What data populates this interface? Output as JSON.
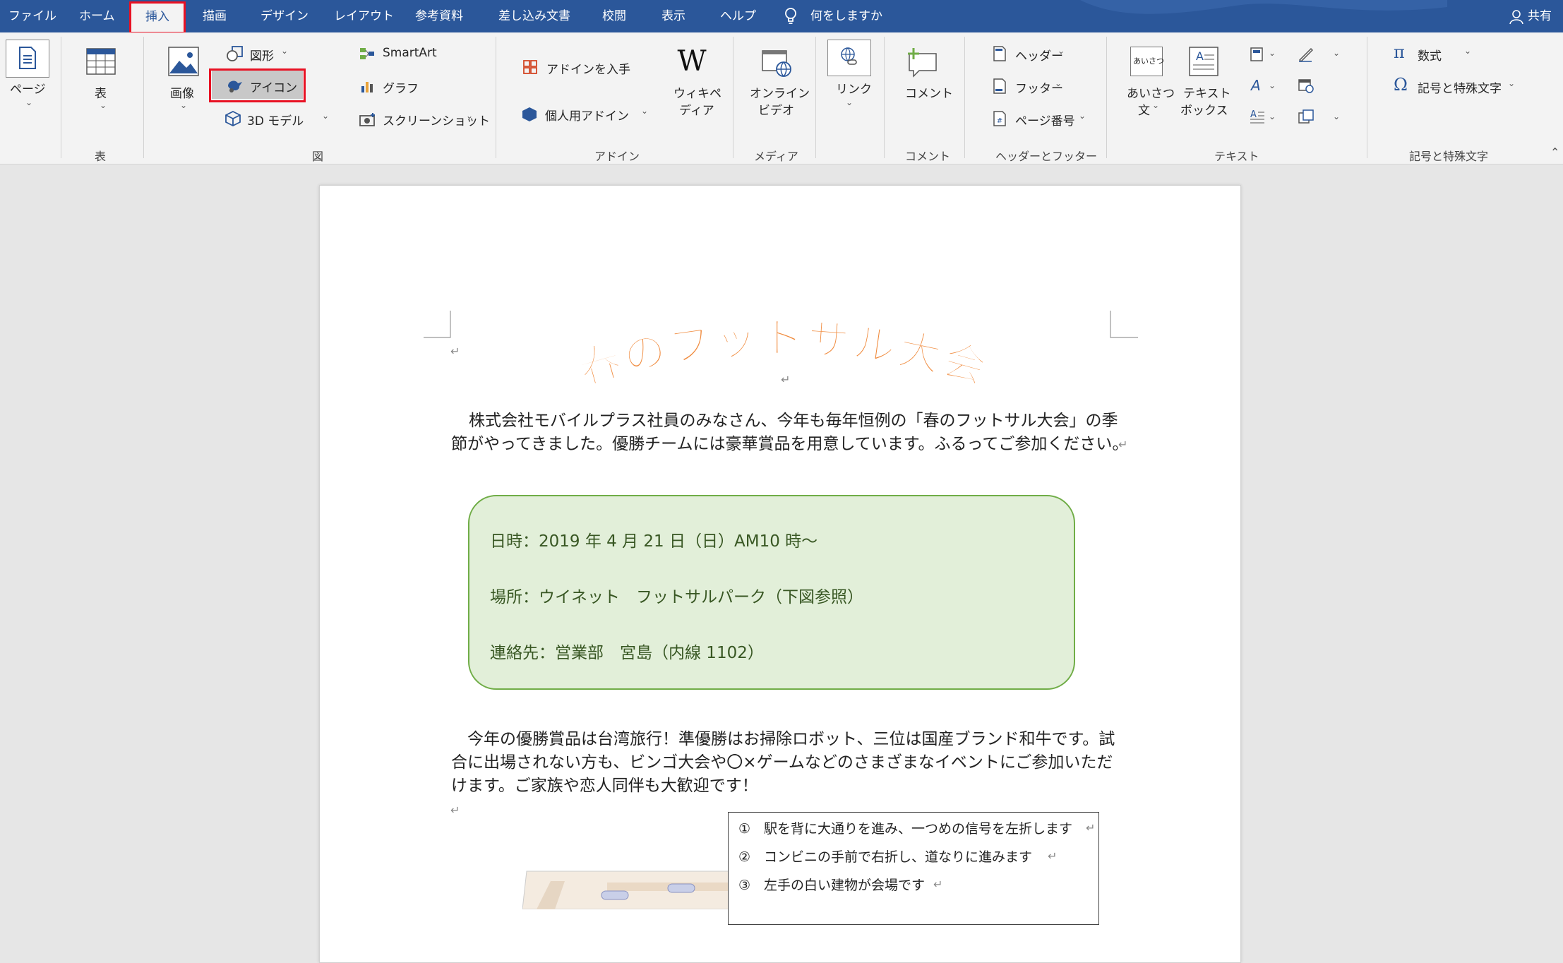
{
  "tabs": {
    "file": "ファイル",
    "home": "ホーム",
    "insert": "挿入",
    "draw": "描画",
    "design": "デザイン",
    "layout": "レイアウト",
    "references": "参考資料",
    "mailings": "差し込み文書",
    "review": "校閲",
    "view": "表示",
    "help": "ヘルプ",
    "tell_me": "何をしますか",
    "share": "共有"
  },
  "ribbon": {
    "pages": {
      "label": "ページ"
    },
    "tables": {
      "table": "表",
      "group": "表"
    },
    "illustrations": {
      "pictures": "画像",
      "shapes": "図形",
      "icons": "アイコン",
      "models3d": "3D モデル",
      "smartart": "SmartArt",
      "chart": "グラフ",
      "screenshot": "スクリーンショット",
      "group": "図"
    },
    "addins": {
      "get": "アドインを入手",
      "my": "個人用アドイン",
      "wiki_1": "ウィキペ",
      "wiki_2": "ディア",
      "group": "アドイン"
    },
    "media": {
      "video_1": "オンライン",
      "video_2": "ビデオ",
      "group": "メディア"
    },
    "links": {
      "link": "リンク"
    },
    "comments": {
      "comment": "コメント",
      "group": "コメント"
    },
    "header_footer": {
      "header": "ヘッダー",
      "footer": "フッター",
      "page_number": "ページ番号",
      "group": "ヘッダーとフッター"
    },
    "text": {
      "greeting_1": "あいさつ",
      "greeting_2": "文",
      "greeting_icon": "あいさつ",
      "textbox_1": "テキスト",
      "textbox_2": "ボックス",
      "group": "テキスト"
    },
    "symbols": {
      "equation": "数式",
      "symbol": "記号と特殊文字",
      "group": "記号と特殊文字"
    }
  },
  "document": {
    "title": "春のフットサル大会",
    "intro_line1": "株式会社モバイルプラス社員のみなさん、今年も毎年恒例の「春のフットサル大会」の季",
    "intro_line2": "節がやってきました。優勝チームには豪華賞品を用意しています。ふるってご参加ください。",
    "info": {
      "date": "日時：2019 年 4 月 21 日（日）AM10 時～",
      "place": "場所：ウイネット　フットサルパーク（下図参照）",
      "contact": "連絡先：営業部　宮島（内線 1102）"
    },
    "prize_line1": "今年の優勝賞品は台湾旅行！準優勝はお掃除ロボット、三位は国産ブランド和牛です。試",
    "prize_line2": "合に出場されない方も、ビンゴ大会や〇×ゲームなどのさまざまなイベントにご参加いただ",
    "prize_line3": "けます。ご家族や恋人同伴も大歓迎です！",
    "route": [
      "①　駅を背に大通りを進み、一つめの信号を左折します",
      "②　コンビニの手前で右折し、道なりに進みます",
      "③　左手の白い建物が会場です"
    ],
    "para_mark": "↵"
  },
  "colors": {
    "accent": "#2b579a",
    "highlight": "#e81123",
    "title_orange": "#f08a3c",
    "box_fill": "#e2efd9",
    "box_border": "#70ad47"
  }
}
